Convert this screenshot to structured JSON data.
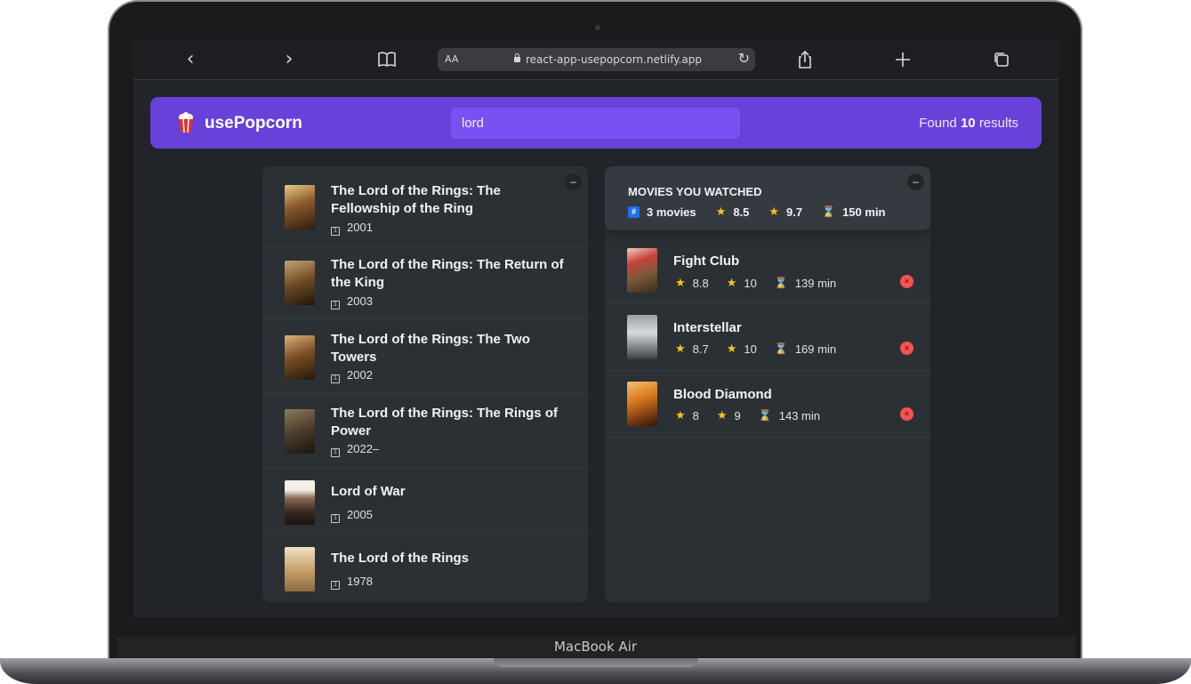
{
  "device": {
    "brand": "MacBook Air"
  },
  "browser": {
    "back_icon": "‹",
    "forward_icon": "›",
    "text_size_label": "AA",
    "url": "react-app-usepopcorn.netlify.app"
  },
  "navbar": {
    "logo_text": "usePopcorn",
    "search_value": "lord",
    "found_prefix": "Found",
    "found_count": "10",
    "found_suffix": "results"
  },
  "colors": {
    "primary": "#6741d9",
    "primary_light": "#7950f2",
    "background": "#212529",
    "box": "#2b3035",
    "red": "#fa5252",
    "star": "#fcc419"
  },
  "search_results": {
    "toggle_label": "–",
    "movies": [
      {
        "title": "The Lord of the Rings: The Fellowship of the Ring",
        "year": "2001"
      },
      {
        "title": "The Lord of the Rings: The Return of the King",
        "year": "2003"
      },
      {
        "title": "The Lord of the Rings: The Two Towers",
        "year": "2002"
      },
      {
        "title": "The Lord of the Rings: The Rings of Power",
        "year": "2022–"
      },
      {
        "title": "Lord of War",
        "year": "2005"
      },
      {
        "title": "The Lord of the Rings",
        "year": "1978"
      }
    ]
  },
  "watched": {
    "toggle_label": "–",
    "summary": {
      "title": "MOVIES YOU WATCHED",
      "count": "3 movies",
      "avg_imdb": "8.5",
      "avg_user": "9.7",
      "avg_runtime": "150 min"
    },
    "movies": [
      {
        "title": "Fight Club",
        "imdb": "8.8",
        "user": "10",
        "runtime": "139 min"
      },
      {
        "title": "Interstellar",
        "imdb": "8.7",
        "user": "10",
        "runtime": "169 min"
      },
      {
        "title": "Blood Diamond",
        "imdb": "8",
        "user": "9",
        "runtime": "143 min"
      }
    ]
  }
}
